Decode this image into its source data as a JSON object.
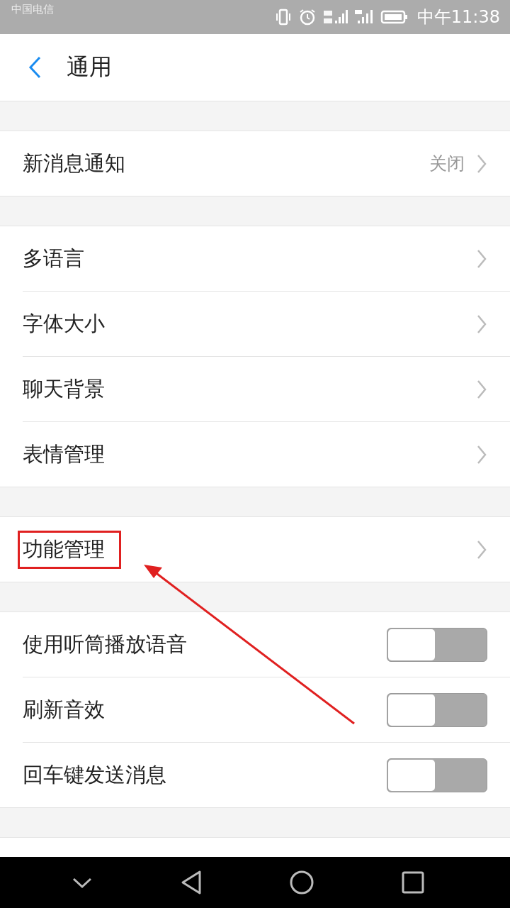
{
  "status_bar": {
    "carrier": "中国电信",
    "time": "中午11:38"
  },
  "header": {
    "title": "通用"
  },
  "sections": [
    {
      "items": [
        {
          "kind": "link",
          "label": "新消息通知",
          "value": "关闭",
          "highlighted": false
        }
      ]
    },
    {
      "items": [
        {
          "kind": "link",
          "label": "多语言",
          "highlighted": false
        },
        {
          "kind": "link",
          "label": "字体大小",
          "highlighted": false
        },
        {
          "kind": "link",
          "label": "聊天背景",
          "highlighted": false
        },
        {
          "kind": "link",
          "label": "表情管理",
          "highlighted": false
        }
      ]
    },
    {
      "items": [
        {
          "kind": "link",
          "label": "功能管理",
          "highlighted": true
        }
      ]
    },
    {
      "items": [
        {
          "kind": "switch",
          "label": "使用听筒播放语音",
          "on": false,
          "highlighted": false
        },
        {
          "kind": "switch",
          "label": "刷新音效",
          "on": false,
          "highlighted": false
        },
        {
          "kind": "switch",
          "label": "回车键发送消息",
          "on": false,
          "highlighted": false
        }
      ]
    }
  ]
}
